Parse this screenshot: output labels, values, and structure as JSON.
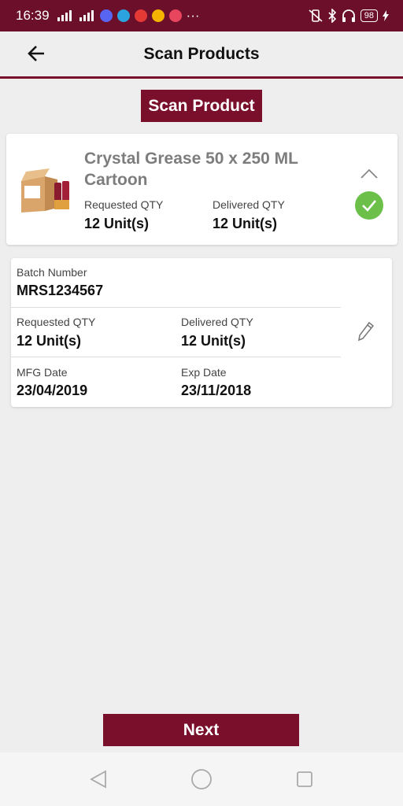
{
  "status_bar": {
    "time": "16:39",
    "more": "···",
    "battery": "98"
  },
  "header": {
    "title": "Scan Products"
  },
  "scan_button": {
    "label": "Scan Product"
  },
  "product": {
    "name": "Crystal Grease 50 x 250 ML Cartoon",
    "requested_label": "Requested QTY",
    "requested_value": "12 Unit(s)",
    "delivered_label": "Delivered QTY",
    "delivered_value": "12 Unit(s)",
    "status": "check-icon",
    "accent": "#6cc04a"
  },
  "batch": {
    "batch_label": "Batch Number",
    "batch_value": "MRS1234567",
    "requested_label": "Requested QTY",
    "requested_value": "12 Unit(s)",
    "delivered_label": "Delivered QTY",
    "delivered_value": "12 Unit(s)",
    "mfg_label": "MFG Date",
    "mfg_value": "23/04/2019",
    "exp_label": "Exp Date",
    "exp_value": "23/11/2018"
  },
  "next_button": {
    "label": "Next"
  },
  "colors": {
    "brand": "#7a0f2c",
    "status_bar": "#6b0f2a",
    "background": "#eeeeee"
  }
}
